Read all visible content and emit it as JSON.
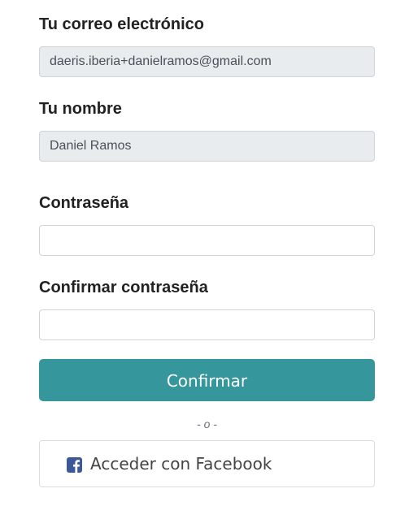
{
  "form": {
    "email": {
      "label": "Tu correo electrónico",
      "value": "daeris.iberia+danielramos@gmail.com"
    },
    "name": {
      "label": "Tu nombre",
      "value": "Daniel Ramos"
    },
    "password": {
      "label": "Contraseña",
      "value": ""
    },
    "confirm_password": {
      "label": "Confirmar contraseña",
      "value": ""
    },
    "submit_label": "Confirmar",
    "divider_text": "- o -",
    "facebook": {
      "label": "Acceder con Facebook",
      "icon": "facebook-icon",
      "icon_color": "#3b5998"
    },
    "accent_color": "#35979b"
  }
}
